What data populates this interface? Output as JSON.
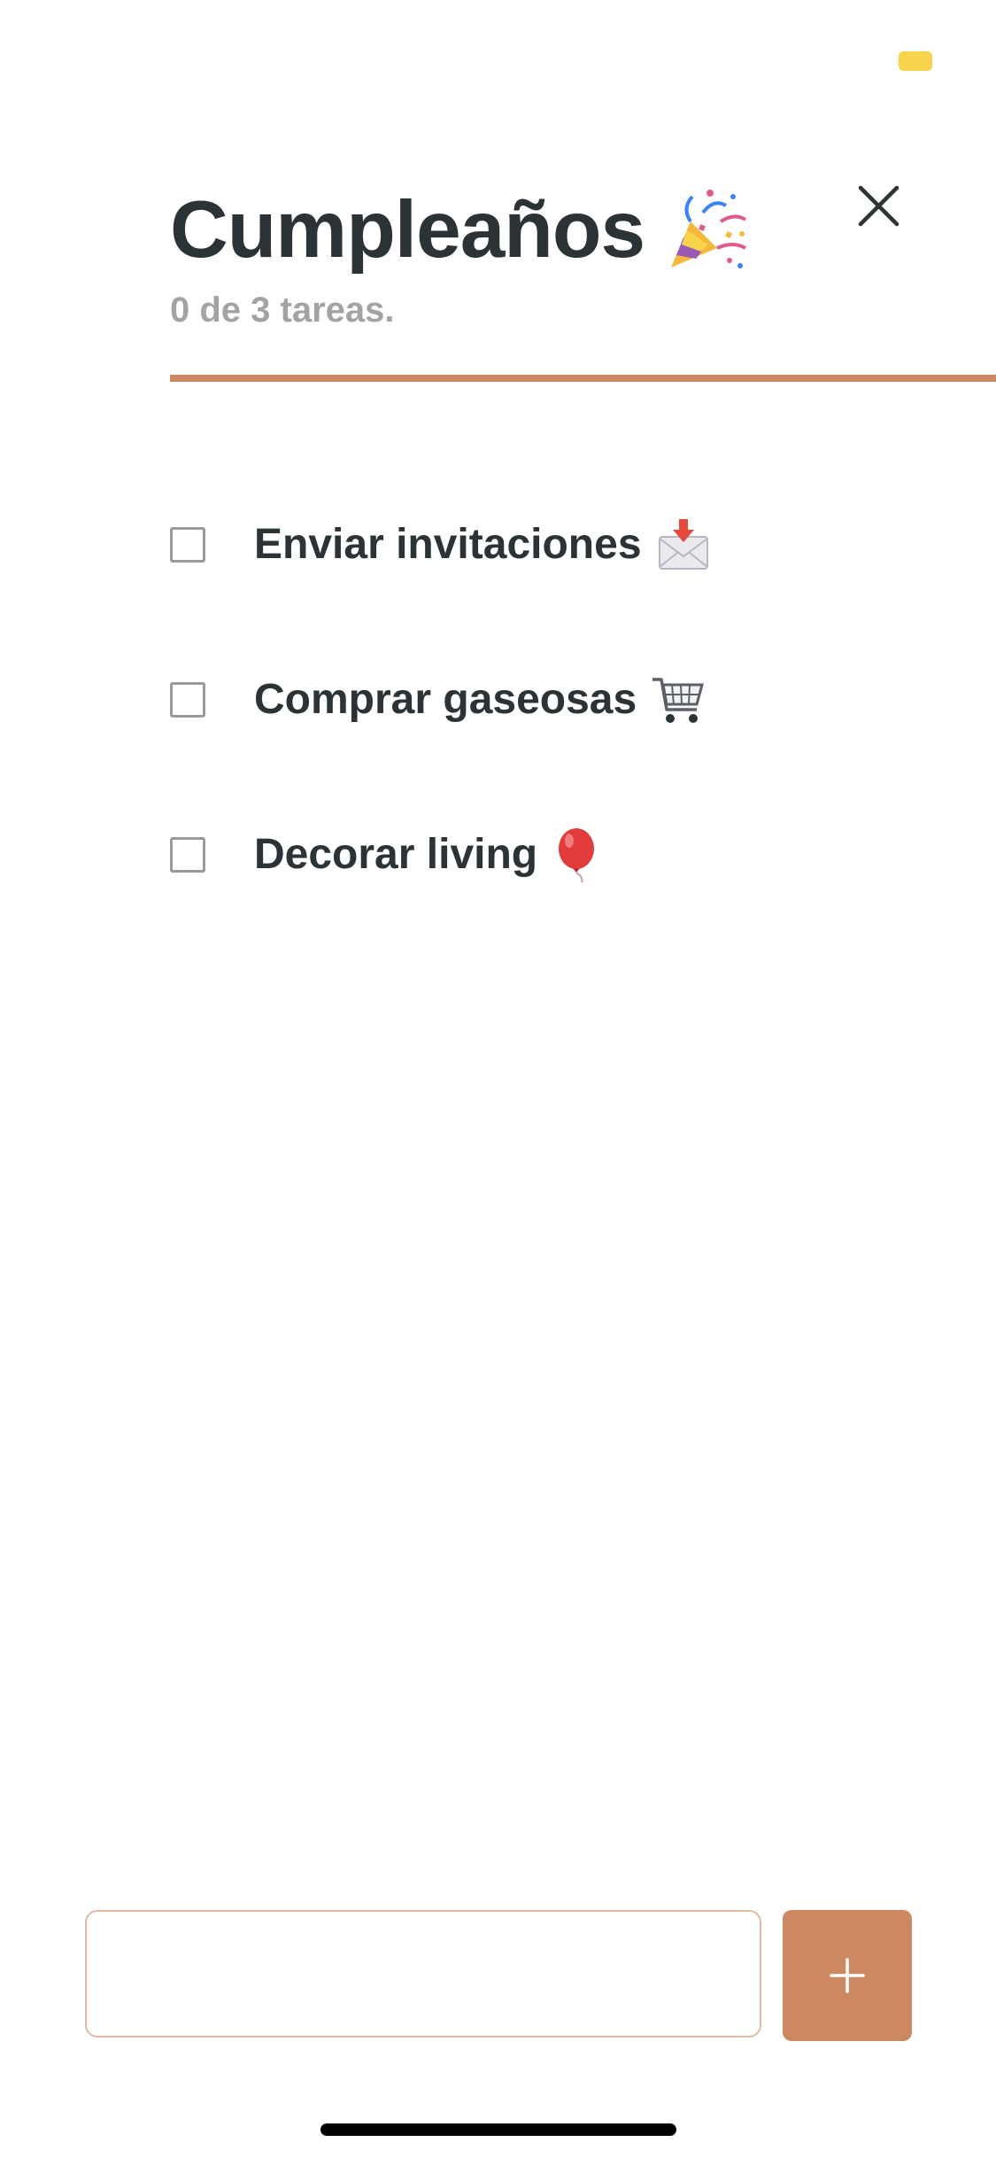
{
  "status_bar": {
    "battery_color": "#f7d44c"
  },
  "header": {
    "title": "Cumpleaños",
    "title_icon": "party-popper-icon",
    "subtitle": "0 de 3 tareas.",
    "close_icon": "close-icon"
  },
  "progress": {
    "completed": 0,
    "total": 3,
    "fraction": 0,
    "color": "#cc8861"
  },
  "tasks": [
    {
      "label": "Enviar invitaciones",
      "icon": "envelope-with-arrow-icon",
      "done": false
    },
    {
      "label": "Comprar gaseosas",
      "icon": "shopping-cart-icon",
      "done": false
    },
    {
      "label": "Decorar living",
      "icon": "balloon-icon",
      "done": false
    }
  ],
  "composer": {
    "input_value": "",
    "input_placeholder": "",
    "add_icon": "plus-icon",
    "accent_color": "#cc8861"
  }
}
